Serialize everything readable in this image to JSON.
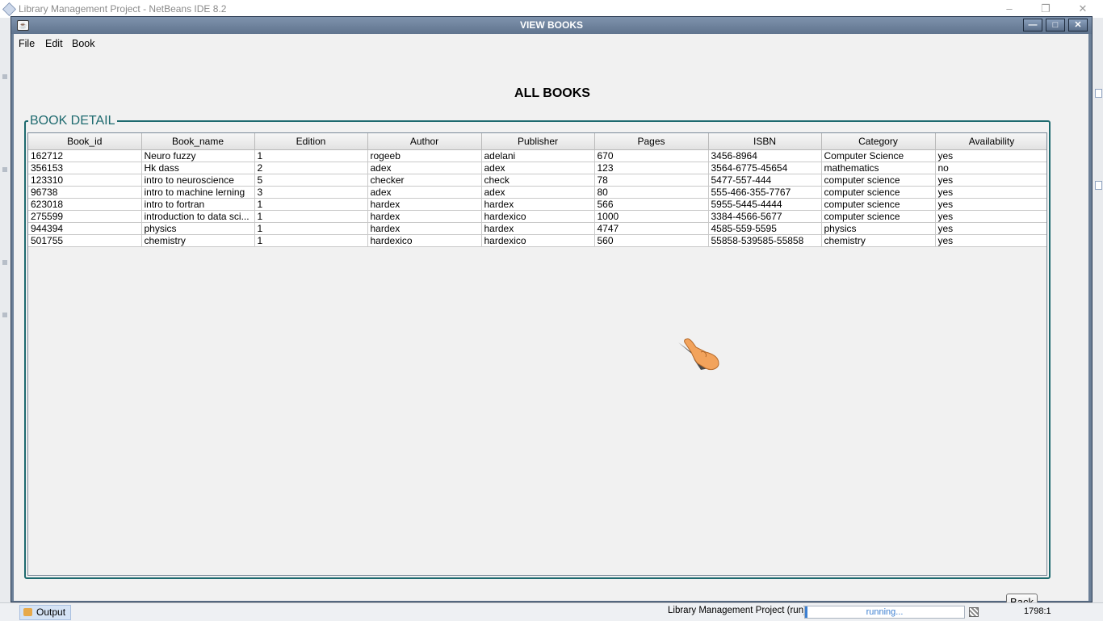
{
  "ide": {
    "title": "Library Management Project - NetBeans IDE 8.2",
    "output_tab": "Output",
    "status_run": "Library Management Project (run)",
    "progress_text": "running...",
    "position": "1798:1"
  },
  "dialog": {
    "title": "VIEW BOOKS",
    "menu": [
      "File",
      "Edit",
      "Book"
    ],
    "heading": "ALL BOOKS",
    "fieldset_title": "BOOK DETAIL",
    "back_label": "Back"
  },
  "table": {
    "columns": [
      "Book_id",
      "Book_name",
      "Edition",
      "Author",
      "Publisher",
      "Pages",
      "ISBN",
      "Category",
      "Availability"
    ],
    "rows": [
      [
        "162712",
        "Neuro fuzzy",
        "1",
        "rogeeb",
        "adelani",
        "670",
        "3456-8964",
        "Computer Science",
        "yes"
      ],
      [
        "356153",
        "Hk dass",
        "2",
        "adex",
        "adex",
        "123",
        "3564-6775-45654",
        "mathematics",
        "no"
      ],
      [
        "123310",
        "intro to neuroscience",
        "5",
        "checker",
        "check",
        "78",
        "5477-557-444",
        "computer science",
        "yes"
      ],
      [
        "96738",
        "intro to machine lerning",
        "3",
        "adex",
        "adex",
        "80",
        "555-466-355-7767",
        "computer science",
        "yes"
      ],
      [
        "623018",
        "intro to fortran",
        "1",
        "hardex",
        "hardex",
        "566",
        "5955-5445-4444",
        "computer science",
        "yes"
      ],
      [
        "275599",
        "introduction to data sci...",
        "1",
        "hardex",
        "hardexico",
        "1000",
        "3384-4566-5677",
        "computer science",
        "yes"
      ],
      [
        "944394",
        "physics",
        "1",
        "hardex",
        "hardex",
        "4747",
        "4585-559-5595",
        "physics",
        "yes"
      ],
      [
        "501755",
        "chemistry",
        "1",
        "hardexico",
        "hardexico",
        "560",
        "55858-539585-55858",
        "chemistry",
        "yes"
      ]
    ]
  },
  "colors": {
    "accent": "#1e6a6f",
    "titlebar": "#6b7f97"
  },
  "icons": [
    "coffee-cup-icon",
    "minimize-icon",
    "maximize-icon",
    "close-icon",
    "hand-pointer-cursor"
  ]
}
